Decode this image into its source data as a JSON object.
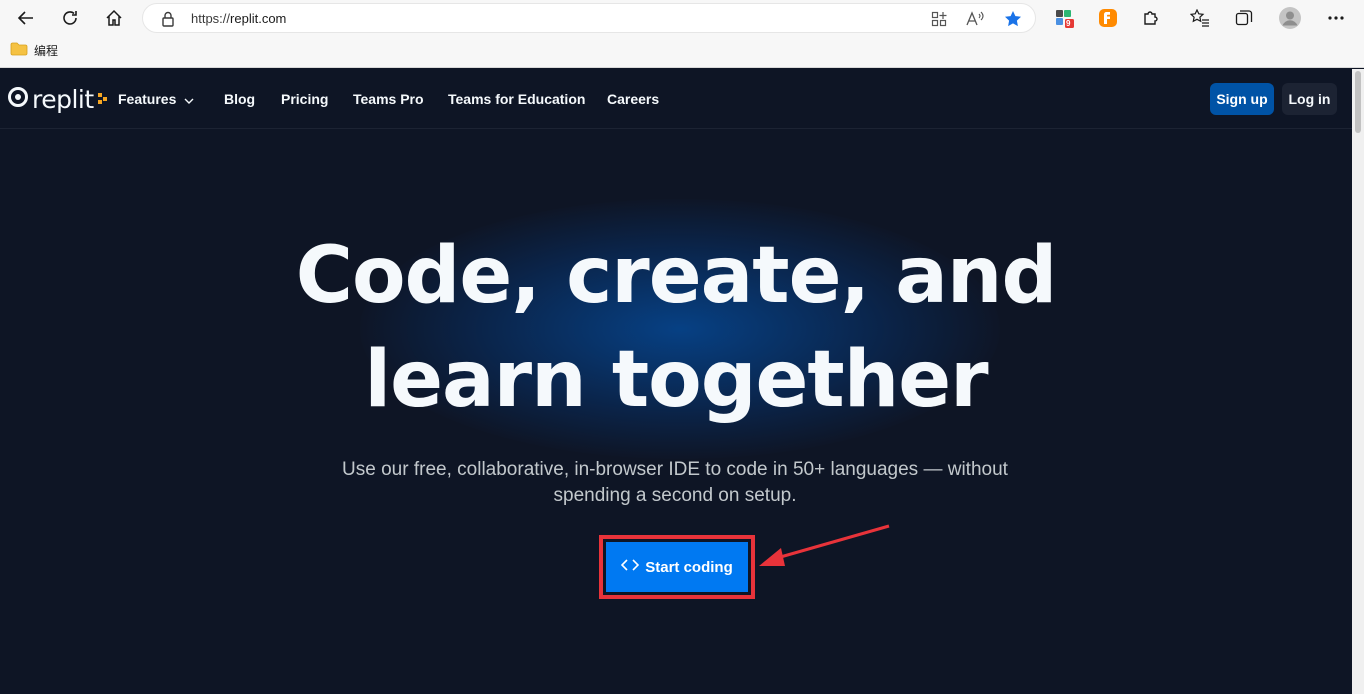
{
  "browser": {
    "url_scheme": "https://",
    "url_host": "replit.com",
    "extension_badge": "9",
    "bookmark_folder": "编程"
  },
  "nav": {
    "logo_text": "replit",
    "links": {
      "features": "Features",
      "blog": "Blog",
      "pricing": "Pricing",
      "teams_pro": "Teams Pro",
      "teams_education": "Teams for Education",
      "careers": "Careers"
    },
    "signup": "Sign up",
    "login": "Log in"
  },
  "hero": {
    "title_line1": "Code, create, and",
    "title_line2": "learn together",
    "subtitle_line1": "Use our free, collaborative, in-browser IDE to code in 50+ languages — without",
    "subtitle_line2": "spending a second on setup.",
    "cta": "Start coding"
  },
  "colors": {
    "page_bg": "#0e1525",
    "primary": "#0079f2",
    "signup_bg": "#0053a6",
    "annotation_red": "#e8333a"
  }
}
